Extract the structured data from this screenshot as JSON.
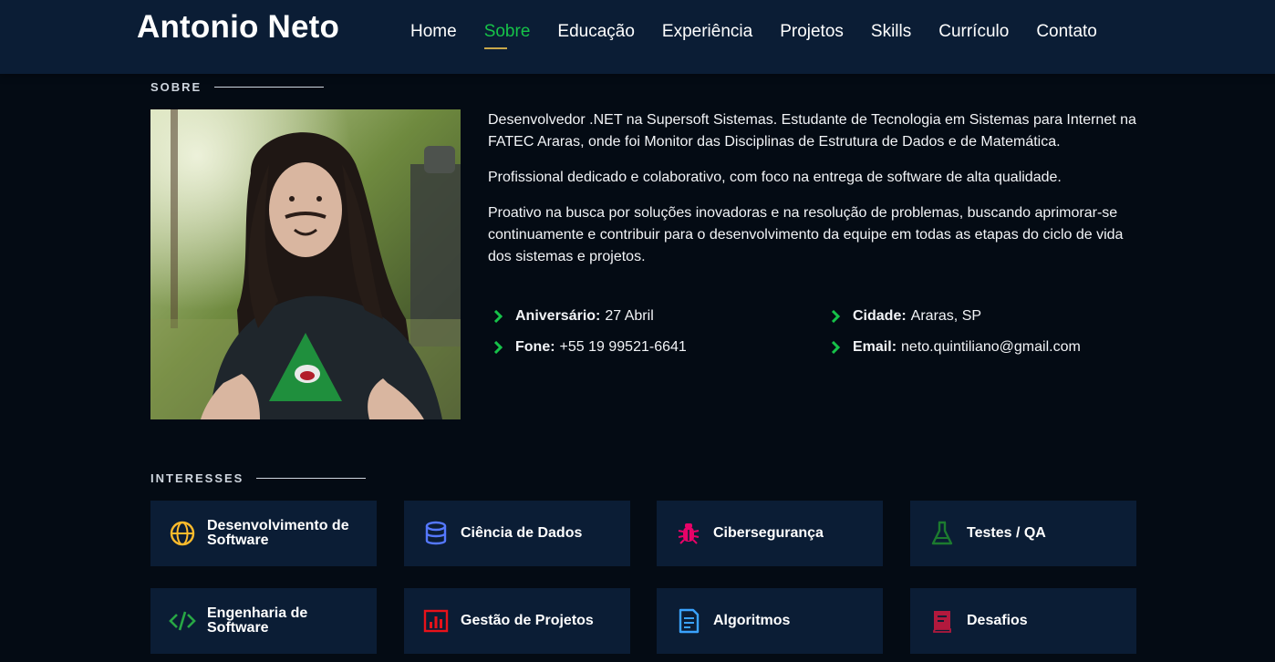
{
  "header": {
    "logo": "Antonio Neto",
    "nav": [
      "Home",
      "Sobre",
      "Educação",
      "Experiência",
      "Projetos",
      "Skills",
      "Currículo",
      "Contato"
    ],
    "active_nav": "Sobre"
  },
  "about": {
    "section_title": "SOBRE",
    "paragraphs": [
      "Desenvolvedor .NET na Supersoft Sistemas. Estudante de Tecnologia em Sistemas para Internet na FATEC Araras, onde foi Monitor das Disciplinas de Estrutura de Dados e de Matemática.",
      "Profissional dedicado e colaborativo, com foco na entrega de software de alta qualidade.",
      "Proativo na busca por soluções inovadoras e na resolução de problemas, buscando aprimorar-se continuamente e contribuir para o desenvolvimento da equipe em todas as etapas do ciclo de vida dos sistemas e projetos."
    ],
    "details": [
      {
        "label": "Aniversário:",
        "value": "27 Abril"
      },
      {
        "label": "Cidade:",
        "value": "Araras, SP"
      },
      {
        "label": "Fone:",
        "value": "+55 19 99521-6641"
      },
      {
        "label": "Email:",
        "value": "neto.quintiliano@gmail.com"
      }
    ]
  },
  "interests": {
    "section_title": "INTERESSES",
    "items": [
      {
        "title": "Desenvolvimento de Software",
        "icon": "globe-icon",
        "color": "#ffbb2c"
      },
      {
        "title": "Ciência de Dados",
        "icon": "database-icon",
        "color": "#5578ff"
      },
      {
        "title": "Cibersegurança",
        "icon": "bug-icon",
        "color": "#e80368"
      },
      {
        "title": "Testes / QA",
        "icon": "flask-icon",
        "color": "#1c7b2f"
      },
      {
        "title": "Engenharia de Software",
        "icon": "code-icon",
        "color": "#28a745"
      },
      {
        "title": "Gestão de Projetos",
        "icon": "bar-chart-icon",
        "color": "#e8121a"
      },
      {
        "title": "Algoritmos",
        "icon": "document-icon",
        "color": "#3aa3ff"
      },
      {
        "title": "Desafios",
        "icon": "book-icon",
        "color": "#b2193d"
      }
    ]
  },
  "colors": {
    "accent": "#16c249",
    "background": "#040b14",
    "panel": "#0b1d35"
  }
}
